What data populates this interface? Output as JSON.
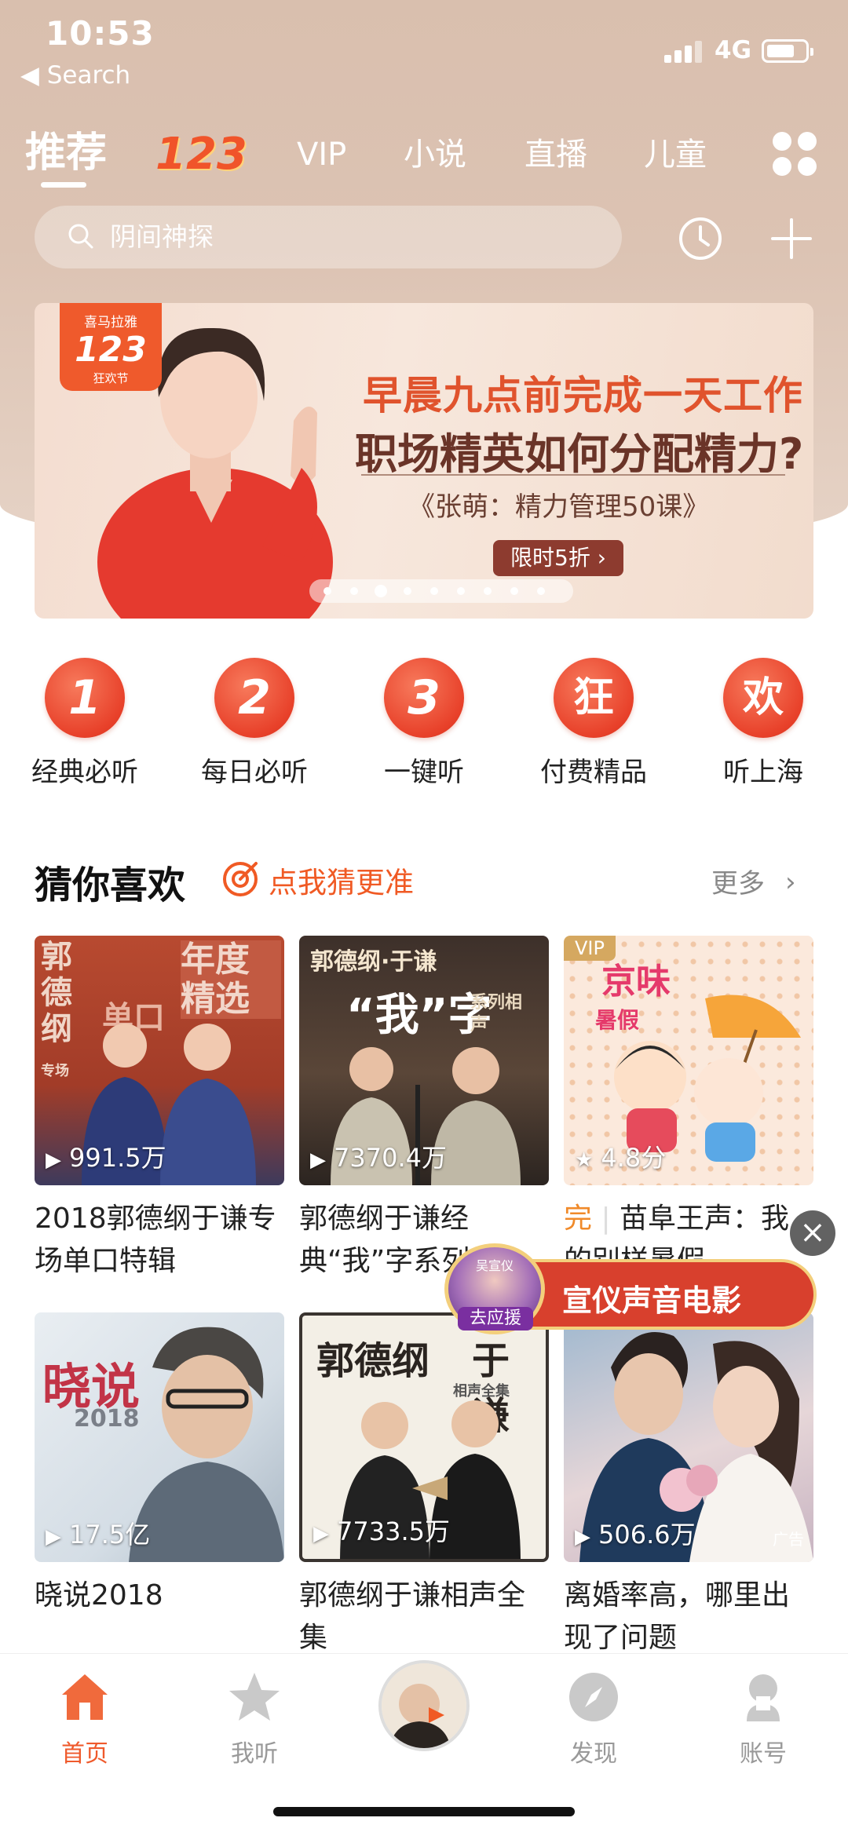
{
  "status_bar": {
    "time": "10:53",
    "back_label": "◀ Search",
    "network": "4G"
  },
  "top_tabs": [
    {
      "label": "推荐"
    },
    {
      "label": "123"
    },
    {
      "label": "VIP"
    },
    {
      "label": "小说"
    },
    {
      "label": "直播"
    },
    {
      "label": "儿童"
    }
  ],
  "search": {
    "placeholder": "阴间神探"
  },
  "banner": {
    "badge_top": "喜马拉雅",
    "badge_number": "123",
    "badge_bottom": "狂欢节",
    "headline": "早晨九点前完成一天工作",
    "subheadline": "职场精英如何分配精力?",
    "book": "《张萌：精力管理50课》",
    "cta": "限时5折 ›",
    "dots_total": 9,
    "dot_active_index": 2
  },
  "quick_links": [
    {
      "icon_text": "1",
      "label": "经典必听"
    },
    {
      "icon_text": "2",
      "label": "每日必听"
    },
    {
      "icon_text": "3",
      "label": "一键听"
    },
    {
      "icon_text": "狂",
      "label": "付费精品"
    },
    {
      "icon_text": "欢",
      "label": "听上海"
    }
  ],
  "section": {
    "title": "猜你喜欢",
    "link": "点我猜更准",
    "more": "更多"
  },
  "cards": [
    {
      "plays": "991.5万",
      "title": "2018郭德纲于谦专场单口特辑",
      "cover_text": [
        "郭德纲",
        "年度精选",
        "单口",
        "专场"
      ]
    },
    {
      "plays": "7370.4万",
      "title": "郭德纲于谦经典“我”字系列",
      "cover_text": [
        "郭德纲·于谦",
        "“我”字",
        "系列相声"
      ]
    },
    {
      "plays": "4.8分",
      "title": "苗阜王声：我的别样暑假",
      "done": "完",
      "vip": "VIP",
      "cover_text": [
        "京味",
        "暑假"
      ]
    },
    {
      "plays": "17.5亿",
      "title": "晓说2018",
      "cover_text": [
        "晓说",
        "2018"
      ]
    },
    {
      "plays": "7733.5万",
      "title": "郭德纲于谦相声全集",
      "cover_text": [
        "郭德纲",
        "于谦",
        "相声全集"
      ]
    },
    {
      "plays": "506.6万",
      "title": "离婚率高，哪里出现了问题",
      "ad": "广告"
    }
  ],
  "float_ad": {
    "text": "宣仪声音电影",
    "avatar_label": "去应援",
    "avatar_name": "吴宣仪"
  },
  "bottom_nav": [
    {
      "label": "首页"
    },
    {
      "label": "我听"
    },
    {
      "label": "发现"
    },
    {
      "label": "账号"
    }
  ],
  "colors": {
    "accent": "#ef5a2c",
    "header_bg": "#d9bfae",
    "vip_gold": "#d5a860"
  }
}
